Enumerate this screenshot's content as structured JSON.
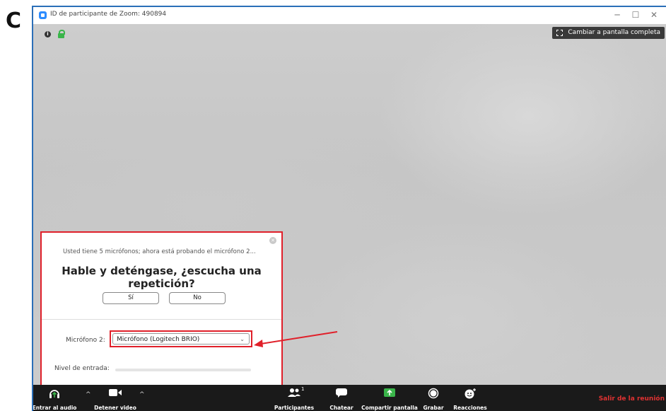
{
  "panel_letter": "C",
  "window": {
    "title": "ID de participante de Zoom: 490894",
    "controls": {
      "minimize": "─",
      "maximize": "☐",
      "close": "✕"
    }
  },
  "header": {
    "fullscreen_label": "Cambiar a pantalla completa"
  },
  "audio_test": {
    "info": "Usted tiene 5 micrófonos; ahora está probando el micrófono 2...",
    "question": "Hable y deténgase, ¿escucha una repetición?",
    "yes_label": "Sí",
    "no_label": "No",
    "mic_label": "Micrófono 2:",
    "mic_selected": "Micrófono (Logitech BRIO)",
    "level_label": "Nivel de entrada:",
    "level_fraction": 0.0
  },
  "toolbar": {
    "join_audio": "Entrar al audio",
    "stop_video": "Detener video",
    "participants": "Participantes",
    "participants_count": "1",
    "chat": "Chatear",
    "share": "Compartir pantalla",
    "record": "Grabar",
    "reactions": "Reacciones",
    "leave": "Salir de la reunión"
  },
  "colors": {
    "highlight": "#e0202a",
    "share_green": "#3ab54a",
    "toolbar_bg": "#1a1a1a",
    "leave_red": "#e03232"
  }
}
